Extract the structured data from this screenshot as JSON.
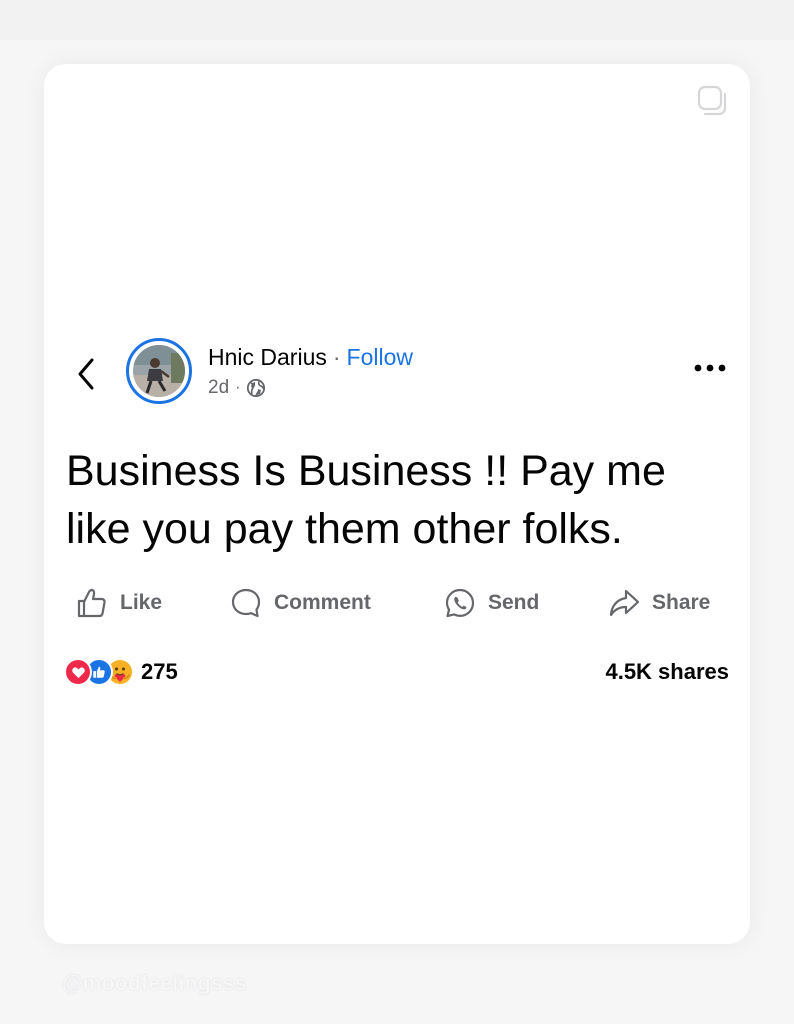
{
  "post": {
    "author": "Hnic Darius",
    "separator": "·",
    "follow_label": "Follow",
    "time": "2d",
    "meta_separator": "·",
    "audience_icon": "globe-icon",
    "text": "Business Is Business !! Pay me like you pay them other folks."
  },
  "actions": {
    "like": "Like",
    "comment": "Comment",
    "send": "Send",
    "share": "Share"
  },
  "stats": {
    "reaction_icons": [
      "love-reaction-icon",
      "like-reaction-icon",
      "care-reaction-icon"
    ],
    "reaction_count": "275",
    "shares": "4.5K shares"
  },
  "watermark": "@moodfeelingsss",
  "colors": {
    "accent": "#1b74e4",
    "text": "#050505",
    "secondary": "#65676b",
    "love": "#f0284a"
  }
}
